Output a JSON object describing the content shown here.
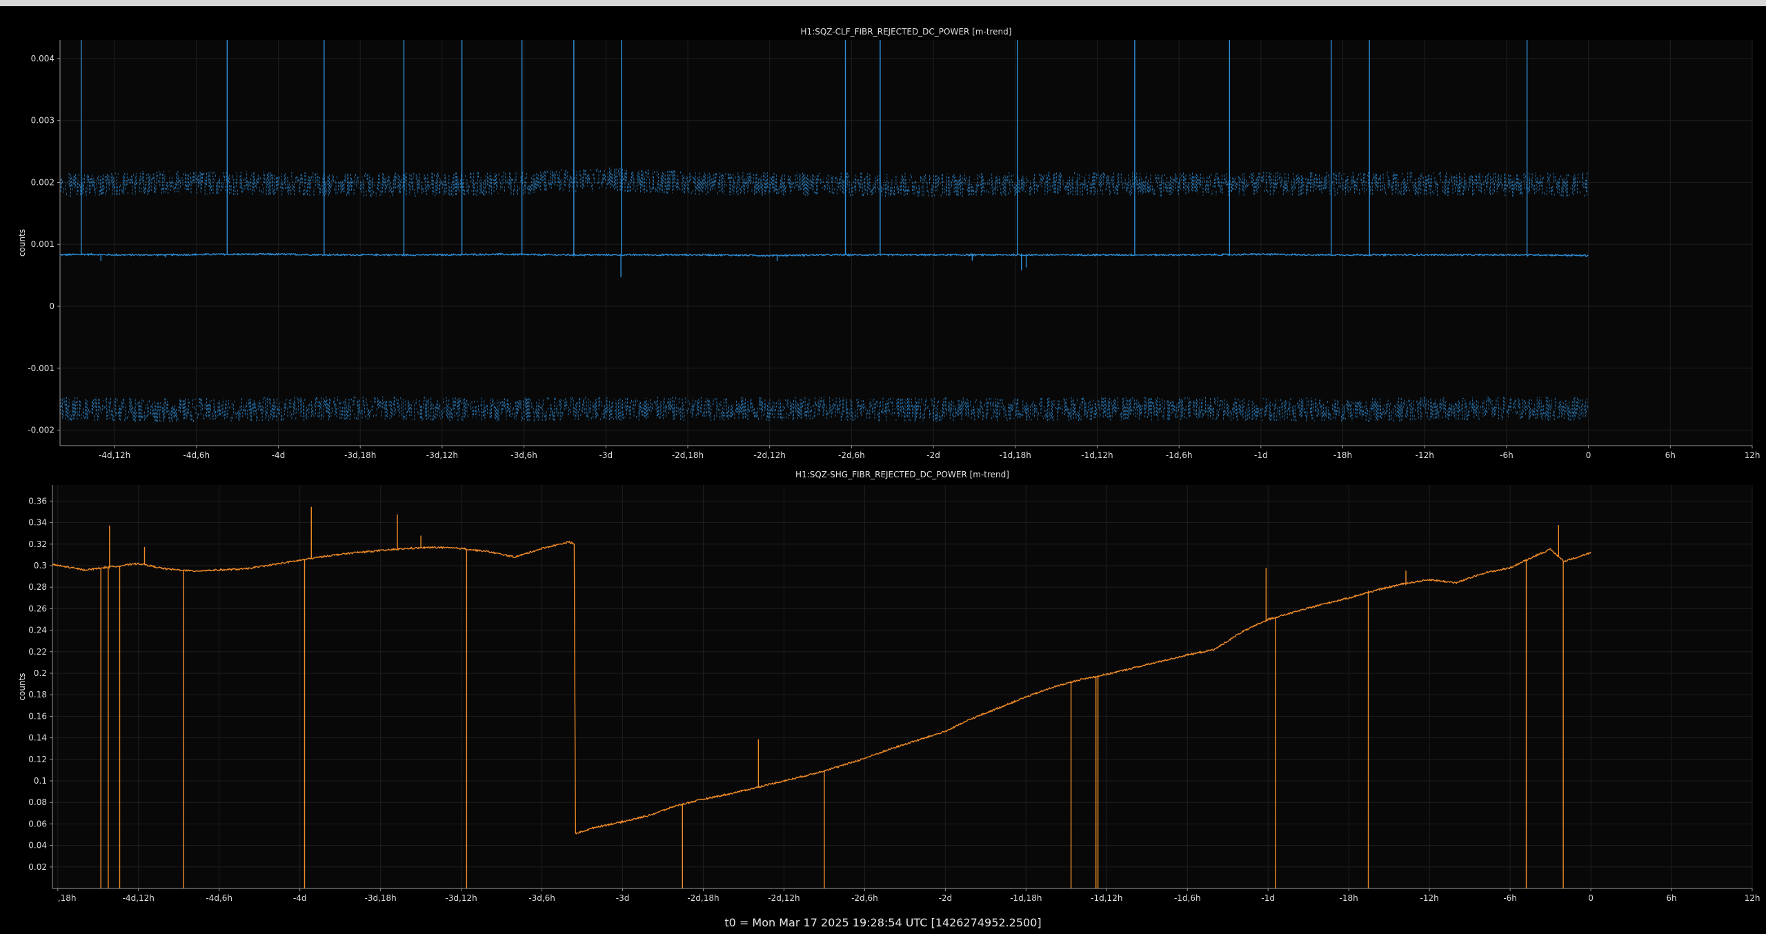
{
  "window": {
    "title": ""
  },
  "footer": {
    "t0_label": "t0 = Mon Mar 17 2025 19:28:54 UTC [1426274952.2500]"
  },
  "chart_data": [
    {
      "type": "line",
      "title": "H1:SQZ-CLF_FIBR_REJECTED_DC_POWER [m-trend]",
      "ylabel": "counts",
      "xlabel": "",
      "color": "#2f8fd8",
      "grid": true,
      "x_unit": "hours relative to t0",
      "xlim": [
        -112,
        12
      ],
      "ylim": [
        -0.00225,
        0.0043
      ],
      "yticks": [
        {
          "v": 0.004,
          "label": "0.004"
        },
        {
          "v": 0.003,
          "label": "0.003"
        },
        {
          "v": 0.002,
          "label": "0.002"
        },
        {
          "v": 0.001,
          "label": "0.001"
        },
        {
          "v": 0,
          "label": "0"
        },
        {
          "v": -0.001,
          "label": "-0.001"
        },
        {
          "v": -0.002,
          "label": "-0.002"
        }
      ],
      "xticks": [
        {
          "v": -108,
          "label": "-4d,12h"
        },
        {
          "v": -102,
          "label": "-4d,6h"
        },
        {
          "v": -96,
          "label": "-4d"
        },
        {
          "v": -90,
          "label": "-3d,18h"
        },
        {
          "v": -84,
          "label": "-3d,12h"
        },
        {
          "v": -78,
          "label": "-3d,6h"
        },
        {
          "v": -72,
          "label": "-3d"
        },
        {
          "v": -66,
          "label": "-2d,18h"
        },
        {
          "v": -60,
          "label": "-2d,12h"
        },
        {
          "v": -54,
          "label": "-2d,6h"
        },
        {
          "v": -48,
          "label": "-2d"
        },
        {
          "v": -42,
          "label": "-1d,18h"
        },
        {
          "v": -36,
          "label": "-1d,12h"
        },
        {
          "v": -30,
          "label": "-1d,6h"
        },
        {
          "v": -24,
          "label": "-1d"
        },
        {
          "v": -18,
          "label": "-18h"
        },
        {
          "v": -12,
          "label": "-12h"
        },
        {
          "v": -6,
          "label": "-6h"
        },
        {
          "v": 0,
          "label": "0"
        },
        {
          "v": 6,
          "label": "6h"
        },
        {
          "v": 12,
          "label": "12h"
        }
      ],
      "series": [
        {
          "style": "solid",
          "x": [
            -112,
            -110,
            -108,
            -104,
            -100,
            -96,
            -92,
            -88,
            -84,
            -80,
            -76,
            -72,
            -68,
            -64,
            -60,
            -56,
            -52,
            -48,
            -44,
            -40,
            -36,
            -32,
            -28,
            -24,
            -20,
            -16,
            -12,
            -8,
            -4,
            0
          ],
          "y": [
            0.00083,
            0.00084,
            0.00083,
            0.00083,
            0.00084,
            0.00084,
            0.00083,
            0.00083,
            0.00083,
            0.00084,
            0.00083,
            0.00083,
            0.00083,
            0.00083,
            0.00082,
            0.00083,
            0.00083,
            0.00083,
            0.00083,
            0.00083,
            0.00083,
            0.00083,
            0.00083,
            0.00084,
            0.00083,
            0.00083,
            0.00083,
            0.00083,
            0.00083,
            0.00082
          ]
        },
        {
          "style": "dashed",
          "x": [
            -112,
            -104,
            -96,
            -88,
            -80,
            -72,
            -64,
            -56,
            -48,
            -40,
            -32,
            -24,
            -16,
            -8,
            0
          ],
          "y": [
            0.00195,
            0.002,
            0.00198,
            0.00196,
            0.00198,
            0.00205,
            0.00198,
            0.00197,
            0.00196,
            0.00198,
            0.00197,
            0.00198,
            0.00198,
            0.00197,
            0.00196
          ]
        },
        {
          "style": "dashed",
          "x": [
            -112,
            -104,
            -96,
            -88,
            -80,
            -72,
            -64,
            -56,
            -48,
            -40,
            -32,
            -24,
            -16,
            -8,
            0
          ],
          "y": [
            -0.00165,
            -0.00168,
            -0.00166,
            -0.00164,
            -0.00167,
            -0.00165,
            -0.00166,
            -0.00165,
            -0.00167,
            -0.00166,
            -0.00165,
            -0.00166,
            -0.00167,
            -0.00165,
            -0.00166
          ]
        }
      ]
    },
    {
      "type": "line",
      "title": "H1:SQZ-SHG_FIBR_REJECTED_DC_POWER [m-trend]",
      "ylabel": "counts",
      "xlabel": "",
      "color": "#f08c28",
      "grid": true,
      "x_unit": "hours relative to t0",
      "xlim": [
        -114.4,
        12
      ],
      "ylim": [
        0,
        0.375
      ],
      "yticks": [
        {
          "v": 0.36,
          "label": "0.36"
        },
        {
          "v": 0.34,
          "label": "0.34"
        },
        {
          "v": 0.32,
          "label": "0.32"
        },
        {
          "v": 0.3,
          "label": "0.3"
        },
        {
          "v": 0.28,
          "label": "0.28"
        },
        {
          "v": 0.26,
          "label": "0.26"
        },
        {
          "v": 0.24,
          "label": "0.24"
        },
        {
          "v": 0.22,
          "label": "0.22"
        },
        {
          "v": 0.2,
          "label": "0.2"
        },
        {
          "v": 0.18,
          "label": "0.18"
        },
        {
          "v": 0.16,
          "label": "0.16"
        },
        {
          "v": 0.14,
          "label": "0.14"
        },
        {
          "v": 0.12,
          "label": "0.12"
        },
        {
          "v": 0.1,
          "label": "0.1"
        },
        {
          "v": 0.08,
          "label": "0.08"
        },
        {
          "v": 0.06,
          "label": "0.06"
        },
        {
          "v": 0.04,
          "label": "0.04"
        },
        {
          "v": 0.02,
          "label": "0.02"
        }
      ],
      "xticks": [
        {
          "v": -114,
          "label": ",18h"
        },
        {
          "v": -108,
          "label": "-4d,12h"
        },
        {
          "v": -102,
          "label": "-4d,6h"
        },
        {
          "v": -96,
          "label": "-4d"
        },
        {
          "v": -90,
          "label": "-3d,18h"
        },
        {
          "v": -84,
          "label": "-3d,12h"
        },
        {
          "v": -78,
          "label": "-3d,6h"
        },
        {
          "v": -72,
          "label": "-3d"
        },
        {
          "v": -66,
          "label": "-2d,18h"
        },
        {
          "v": -60,
          "label": "-2d,12h"
        },
        {
          "v": -54,
          "label": "-2d,6h"
        },
        {
          "v": -48,
          "label": "-2d"
        },
        {
          "v": -42,
          "label": "-1d,18h"
        },
        {
          "v": -36,
          "label": "-1d,12h"
        },
        {
          "v": -30,
          "label": "-1d,6h"
        },
        {
          "v": -24,
          "label": "-1d"
        },
        {
          "v": -18,
          "label": "-18h"
        },
        {
          "v": -12,
          "label": "-12h"
        },
        {
          "v": -6,
          "label": "-6h"
        },
        {
          "v": 0,
          "label": "0"
        },
        {
          "v": 6,
          "label": "6h"
        },
        {
          "v": 12,
          "label": "12h"
        }
      ],
      "series": [
        {
          "style": "solid",
          "x": [
            -114.4,
            -112,
            -110,
            -108,
            -106,
            -104,
            -102,
            -100,
            -98,
            -96,
            -94,
            -92,
            -90,
            -88,
            -86,
            -84,
            -82,
            -80,
            -78,
            -76,
            -75.6,
            -75.5,
            -74,
            -72,
            -70,
            -68,
            -66,
            -64,
            -62,
            -60,
            -58,
            -56,
            -54,
            -52,
            -50,
            -48,
            -46,
            -44,
            -42,
            -40,
            -38,
            -36,
            -34,
            -32,
            -30,
            -28,
            -26,
            -24,
            -22,
            -20,
            -18,
            -16,
            -14,
            -12,
            -10,
            -8,
            -6,
            -5,
            -4,
            -3,
            -2,
            -1,
            0
          ],
          "y": [
            0.301,
            0.296,
            0.299,
            0.302,
            0.297,
            0.295,
            0.296,
            0.297,
            0.301,
            0.305,
            0.309,
            0.312,
            0.314,
            0.316,
            0.317,
            0.316,
            0.313,
            0.308,
            0.316,
            0.322,
            0.32,
            0.051,
            0.057,
            0.062,
            0.068,
            0.077,
            0.083,
            0.088,
            0.094,
            0.1,
            0.106,
            0.113,
            0.121,
            0.13,
            0.138,
            0.146,
            0.158,
            0.168,
            0.178,
            0.187,
            0.194,
            0.199,
            0.205,
            0.211,
            0.217,
            0.222,
            0.238,
            0.25,
            0.257,
            0.264,
            0.27,
            0.277,
            0.283,
            0.287,
            0.284,
            0.293,
            0.298,
            0.304,
            0.31,
            0.315,
            0.304,
            0.308,
            0.312
          ]
        }
      ]
    }
  ]
}
